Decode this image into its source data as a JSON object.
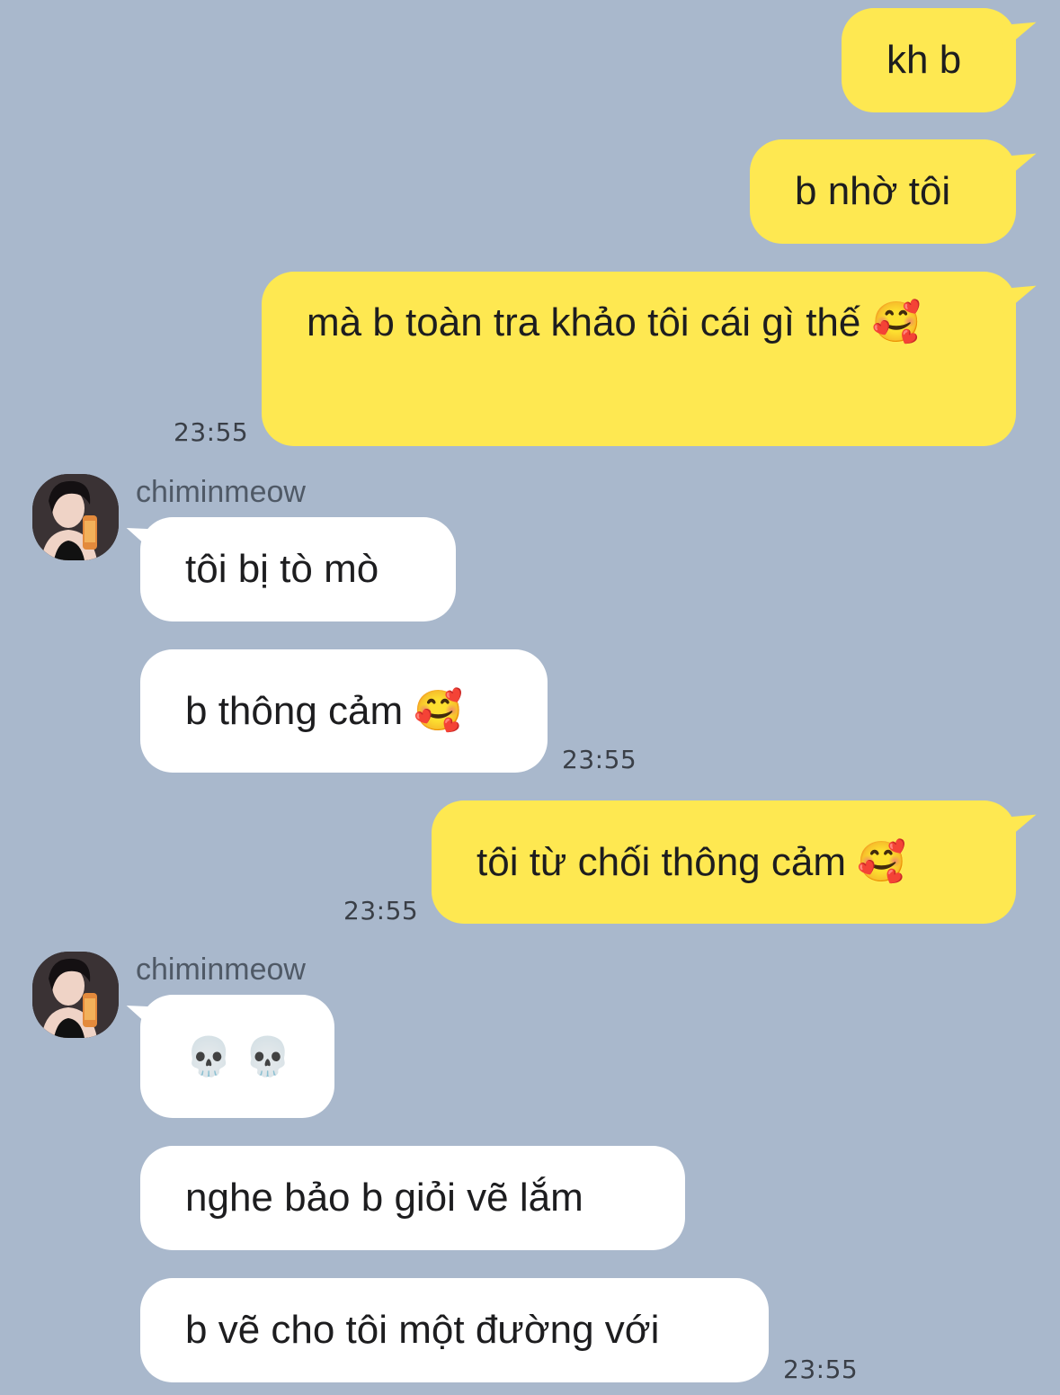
{
  "messages": [
    {
      "text": "kh b"
    },
    {
      "text": "b nhờ tôi"
    },
    {
      "text": "mà b toàn tra khảo tôi cái gì thế 🥰",
      "time": "23:55"
    },
    {
      "sender": "chiminmeow",
      "text": "tôi bị tò mò"
    },
    {
      "text": "b thông cảm 🥰",
      "time": "23:55"
    },
    {
      "text": "tôi từ chối thông cảm 🥰",
      "time": "23:55"
    },
    {
      "sender": "chiminmeow",
      "text": "💀 💀"
    },
    {
      "text": "nghe bảo b giỏi vẽ lắm"
    },
    {
      "text": "b vẽ cho tôi một đường với",
      "time": "23:55"
    }
  ],
  "colors": {
    "background": "#a9b8cc",
    "outgoing_bubble": "#fee851",
    "incoming_bubble": "#ffffff"
  }
}
